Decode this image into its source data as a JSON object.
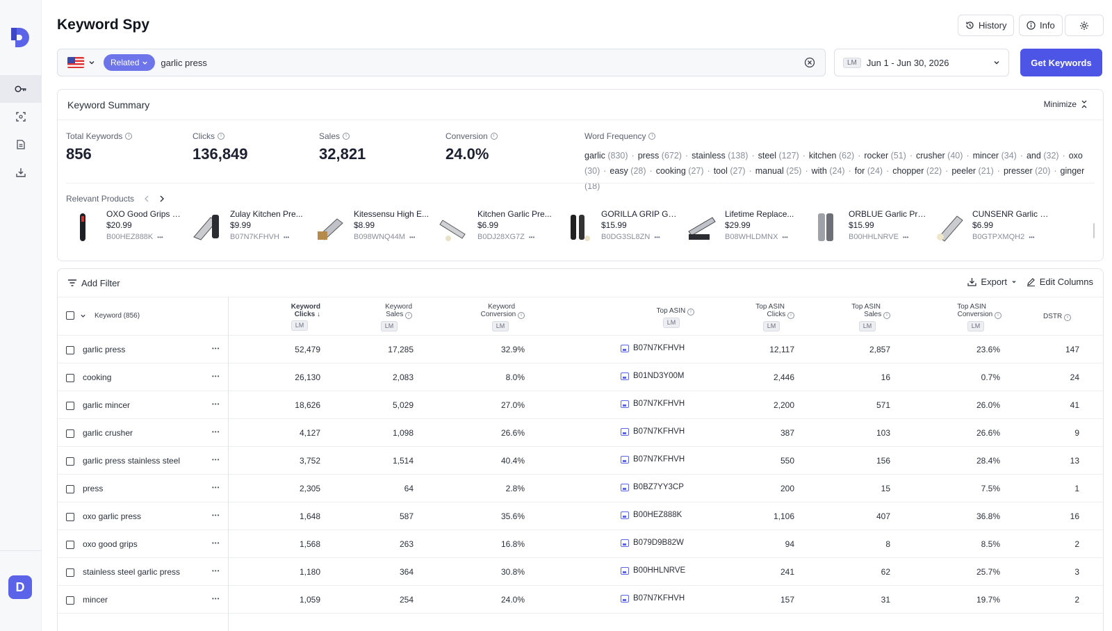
{
  "header": {
    "title": "Keyword Spy",
    "history_label": "History",
    "info_label": "Info"
  },
  "search": {
    "mode_label": "Related",
    "query": "garlic press",
    "date_tag": "LM",
    "date_range": "Jun 1 - Jun 30, 2026",
    "submit_label": "Get Keywords"
  },
  "summary": {
    "title": "Keyword Summary",
    "minimize_label": "Minimize",
    "stats": [
      {
        "label": "Total Keywords",
        "value": "856"
      },
      {
        "label": "Clicks",
        "value": "136,849"
      },
      {
        "label": "Sales",
        "value": "32,821"
      },
      {
        "label": "Conversion",
        "value": "24.0%"
      }
    ],
    "word_frequency_label": "Word Frequency",
    "word_frequency": [
      {
        "word": "garlic",
        "count": "(830)"
      },
      {
        "word": "press",
        "count": "(672)"
      },
      {
        "word": "stainless",
        "count": "(138)"
      },
      {
        "word": "steel",
        "count": "(127)"
      },
      {
        "word": "kitchen",
        "count": "(62)"
      },
      {
        "word": "rocker",
        "count": "(51)"
      },
      {
        "word": "crusher",
        "count": "(40)"
      },
      {
        "word": "mincer",
        "count": "(34)"
      },
      {
        "word": "and",
        "count": "(32)"
      },
      {
        "word": "oxo",
        "count": "(30)"
      },
      {
        "word": "easy",
        "count": "(28)"
      },
      {
        "word": "cooking",
        "count": "(27)"
      },
      {
        "word": "tool",
        "count": "(27)"
      },
      {
        "word": "manual",
        "count": "(25)"
      },
      {
        "word": "with",
        "count": "(24)"
      },
      {
        "word": "for",
        "count": "(24)"
      },
      {
        "word": "chopper",
        "count": "(22)"
      },
      {
        "word": "peeler",
        "count": "(21)"
      },
      {
        "word": "presser",
        "count": "(20)"
      },
      {
        "word": "ginger",
        "count": "(18)"
      }
    ],
    "relevant_products_label": "Relevant Products",
    "products": [
      {
        "name": "OXO Good Grips H...",
        "price": "$20.99",
        "asin": "B00HEZ888K"
      },
      {
        "name": "Zulay Kitchen Pre...",
        "price": "$9.99",
        "asin": "B07N7KFHVH"
      },
      {
        "name": "Kitessensu High E...",
        "price": "$8.99",
        "asin": "B098WNQ44M"
      },
      {
        "name": "Kitchen Garlic Pre...",
        "price": "$6.99",
        "asin": "B0DJ28XG7Z"
      },
      {
        "name": "GORILLA GRIP Garl...",
        "price": "$15.99",
        "asin": "B0DG3SL8ZN"
      },
      {
        "name": "Lifetime Replace...",
        "price": "$29.99",
        "asin": "B08WHLDMNX"
      },
      {
        "name": "ORBLUE Garlic Pre...",
        "price": "$15.99",
        "asin": "B00HHLNRVE"
      },
      {
        "name": "CUNSENR Garlic P...",
        "price": "$6.99",
        "asin": "B0GTPXMQH2"
      }
    ]
  },
  "table": {
    "add_filter_label": "Add Filter",
    "export_label": "Export",
    "edit_columns_label": "Edit Columns",
    "lm_tag": "LM",
    "columns": {
      "keyword": "Keyword (856)",
      "clicks_l1": "Keyword",
      "clicks_l2": "Clicks",
      "sales_l1": "Keyword",
      "sales_l2": "Sales",
      "conv_l1": "Keyword",
      "conv_l2": "Conversion",
      "top_asin": "Top ASIN",
      "asin_clicks_l1": "Top ASIN",
      "asin_clicks_l2": "Clicks",
      "asin_sales_l1": "Top ASIN",
      "asin_sales_l2": "Sales",
      "asin_conv_l1": "Top ASIN",
      "asin_conv_l2": "Conversion",
      "dstr": "DSTR"
    },
    "rows": [
      {
        "keyword": "garlic press",
        "clicks": "52,479",
        "sales": "17,285",
        "conversion": "32.9%",
        "asin": "B07N7KFHVH",
        "asin_clicks": "12,117",
        "asin_sales": "2,857",
        "asin_conversion": "23.6%",
        "dstr": "147"
      },
      {
        "keyword": "cooking",
        "clicks": "26,130",
        "sales": "2,083",
        "conversion": "8.0%",
        "asin": "B01ND3Y00M",
        "asin_clicks": "2,446",
        "asin_sales": "16",
        "asin_conversion": "0.7%",
        "dstr": "24"
      },
      {
        "keyword": "garlic mincer",
        "clicks": "18,626",
        "sales": "5,029",
        "conversion": "27.0%",
        "asin": "B07N7KFHVH",
        "asin_clicks": "2,200",
        "asin_sales": "571",
        "asin_conversion": "26.0%",
        "dstr": "41"
      },
      {
        "keyword": "garlic crusher",
        "clicks": "4,127",
        "sales": "1,098",
        "conversion": "26.6%",
        "asin": "B07N7KFHVH",
        "asin_clicks": "387",
        "asin_sales": "103",
        "asin_conversion": "26.6%",
        "dstr": "9"
      },
      {
        "keyword": "garlic press stainless steel",
        "clicks": "3,752",
        "sales": "1,514",
        "conversion": "40.4%",
        "asin": "B07N7KFHVH",
        "asin_clicks": "550",
        "asin_sales": "156",
        "asin_conversion": "28.4%",
        "dstr": "13"
      },
      {
        "keyword": "press",
        "clicks": "2,305",
        "sales": "64",
        "conversion": "2.8%",
        "asin": "B0BZ7YY3CP",
        "asin_clicks": "200",
        "asin_sales": "15",
        "asin_conversion": "7.5%",
        "dstr": "1"
      },
      {
        "keyword": "oxo garlic press",
        "clicks": "1,648",
        "sales": "587",
        "conversion": "35.6%",
        "asin": "B00HEZ888K",
        "asin_clicks": "1,106",
        "asin_sales": "407",
        "asin_conversion": "36.8%",
        "dstr": "16"
      },
      {
        "keyword": "oxo good grips",
        "clicks": "1,568",
        "sales": "263",
        "conversion": "16.8%",
        "asin": "B079D9B82W",
        "asin_clicks": "94",
        "asin_sales": "8",
        "asin_conversion": "8.5%",
        "dstr": "2"
      },
      {
        "keyword": "stainless steel garlic press",
        "clicks": "1,180",
        "sales": "364",
        "conversion": "30.8%",
        "asin": "B00HHLNRVE",
        "asin_clicks": "241",
        "asin_sales": "62",
        "asin_conversion": "25.7%",
        "dstr": "3"
      },
      {
        "keyword": "mincer",
        "clicks": "1,059",
        "sales": "254",
        "conversion": "24.0%",
        "asin": "B07N7KFHVH",
        "asin_clicks": "157",
        "asin_sales": "31",
        "asin_conversion": "19.7%",
        "dstr": "2"
      }
    ]
  },
  "user": {
    "avatar_letter": "D"
  },
  "colors": {
    "accent": "#4d55e6",
    "pill": "#6e74ea",
    "muted": "#8a8f9c"
  }
}
